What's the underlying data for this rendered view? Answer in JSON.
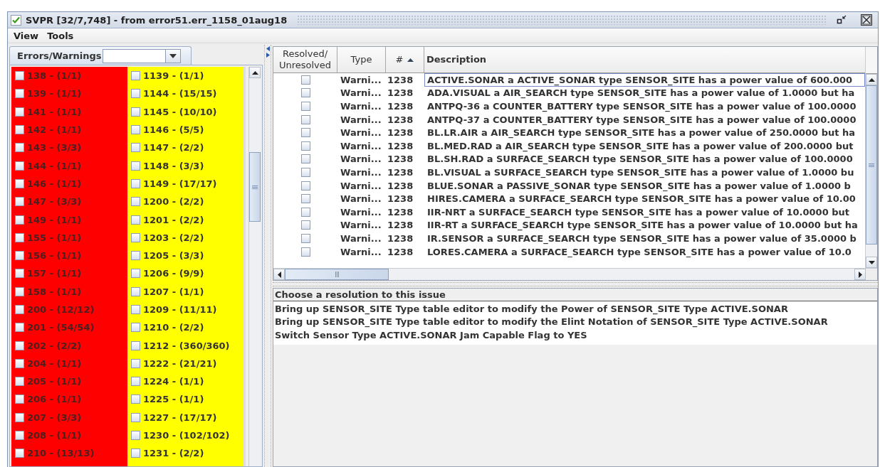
{
  "window": {
    "title": "SVPR [32/7,748] - from error51.err_1158_01aug18"
  },
  "menu": [
    "View",
    "Tools"
  ],
  "errors_panel": {
    "tab": "Errors/Warnings",
    "columns": [
      {
        "color": "#ff0000",
        "items": [
          {
            "label": "138 - (1/1)",
            "checked": false
          },
          {
            "label": "139 - (1/1)",
            "checked": false
          },
          {
            "label": "141 - (1/1)",
            "checked": false
          },
          {
            "label": "142 - (1/1)",
            "checked": false
          },
          {
            "label": "143 - (3/3)",
            "checked": false
          },
          {
            "label": "144 - (1/1)",
            "checked": false
          },
          {
            "label": "146 - (1/1)",
            "checked": false
          },
          {
            "label": "147 - (3/3)",
            "checked": false
          },
          {
            "label": "149 - (1/1)",
            "checked": false
          },
          {
            "label": "155 - (1/1)",
            "checked": false
          },
          {
            "label": "156 - (1/1)",
            "checked": false
          },
          {
            "label": "157 - (1/1)",
            "checked": false
          },
          {
            "label": "158 - (1/1)",
            "checked": false
          },
          {
            "label": "200 - (12/12)",
            "checked": false
          },
          {
            "label": "201 - (54/54)",
            "checked": false
          },
          {
            "label": "202 - (2/2)",
            "checked": false
          },
          {
            "label": "204 - (1/1)",
            "checked": false
          },
          {
            "label": "205 - (1/1)",
            "checked": false
          },
          {
            "label": "206 - (1/1)",
            "checked": false
          },
          {
            "label": "207 - (3/3)",
            "checked": false
          },
          {
            "label": "208 - (1/1)",
            "checked": false
          },
          {
            "label": "210 - (13/13)",
            "checked": false
          }
        ]
      },
      {
        "color": "#ffff00",
        "items": [
          {
            "label": "1139 - (1/1)",
            "checked": false
          },
          {
            "label": "1144 - (15/15)",
            "checked": false
          },
          {
            "label": "1145 - (10/10)",
            "checked": false
          },
          {
            "label": "1146 - (5/5)",
            "checked": false
          },
          {
            "label": "1147 - (2/2)",
            "checked": false
          },
          {
            "label": "1148 - (3/3)",
            "checked": false
          },
          {
            "label": "1149 - (17/17)",
            "checked": false
          },
          {
            "label": "1200 - (2/2)",
            "checked": false
          },
          {
            "label": "1201 - (2/2)",
            "checked": false
          },
          {
            "label": "1203 - (2/2)",
            "checked": false
          },
          {
            "label": "1205 - (3/3)",
            "checked": false
          },
          {
            "label": "1206 - (9/9)",
            "checked": false
          },
          {
            "label": "1207 - (1/1)",
            "checked": false
          },
          {
            "label": "1209 - (11/11)",
            "checked": false
          },
          {
            "label": "1210 - (2/2)",
            "checked": false
          },
          {
            "label": "1212 - (360/360)",
            "checked": false
          },
          {
            "label": "1222 - (21/21)",
            "checked": false
          },
          {
            "label": "1224 - (1/1)",
            "checked": false
          },
          {
            "label": "1225 - (1/1)",
            "checked": false
          },
          {
            "label": "1227 - (17/17)",
            "checked": false
          },
          {
            "label": "1230 - (102/102)",
            "checked": false
          },
          {
            "label": "1231 - (2/2)",
            "checked": false
          }
        ]
      }
    ]
  },
  "table": {
    "columns": [
      {
        "label": "Resolved/\nUnresolved",
        "sorted": false
      },
      {
        "label": "Type",
        "sorted": false
      },
      {
        "label": "#",
        "sorted": true
      },
      {
        "label": "Description",
        "sorted": false
      }
    ],
    "rows": [
      {
        "resolved": false,
        "selected": true,
        "type": "Warni...",
        "number": "1238",
        "description": "ACTIVE.SONAR a ACTIVE_SONAR type SENSOR_SITE has a power value of 600.000"
      },
      {
        "resolved": false,
        "selected": false,
        "type": "Warni...",
        "number": "1238",
        "description": "ADA.VISUAL a AIR_SEARCH type SENSOR_SITE has a power value of 1.0000 but ha"
      },
      {
        "resolved": false,
        "selected": false,
        "type": "Warni...",
        "number": "1238",
        "description": "ANTPQ-36 a COUNTER_BATTERY type SENSOR_SITE has a power value of 100.0000"
      },
      {
        "resolved": false,
        "selected": false,
        "type": "Warni...",
        "number": "1238",
        "description": "ANTPQ-37 a COUNTER_BATTERY type SENSOR_SITE has a power value of 100.0000"
      },
      {
        "resolved": false,
        "selected": false,
        "type": "Warni...",
        "number": "1238",
        "description": "BL.LR.AIR a AIR_SEARCH type SENSOR_SITE has a power value of 250.0000 but ha"
      },
      {
        "resolved": false,
        "selected": false,
        "type": "Warni...",
        "number": "1238",
        "description": "BL.MED.RAD a AIR_SEARCH type SENSOR_SITE has a power value of 200.0000 but"
      },
      {
        "resolved": false,
        "selected": false,
        "type": "Warni...",
        "number": "1238",
        "description": "BL.SH.RAD a SURFACE_SEARCH type SENSOR_SITE has a power value of 100.0000"
      },
      {
        "resolved": false,
        "selected": false,
        "type": "Warni...",
        "number": "1238",
        "description": "BL.VISUAL a SURFACE_SEARCH type SENSOR_SITE has a power value of 1.0000 bu"
      },
      {
        "resolved": false,
        "selected": false,
        "type": "Warni...",
        "number": "1238",
        "description": "BLUE.SONAR a PASSIVE_SONAR type SENSOR_SITE has a power value of 1.0000 b"
      },
      {
        "resolved": false,
        "selected": false,
        "type": "Warni...",
        "number": "1238",
        "description": "HIRES.CAMERA a SURFACE_SEARCH type SENSOR_SITE has a power value of 10.00"
      },
      {
        "resolved": false,
        "selected": false,
        "type": "Warni...",
        "number": "1238",
        "description": "IIR-NRT a SURFACE_SEARCH type SENSOR_SITE has a power value of 10.0000 but"
      },
      {
        "resolved": false,
        "selected": false,
        "type": "Warni...",
        "number": "1238",
        "description": "IIR-RT a SURFACE_SEARCH type SENSOR_SITE has a power value of 10.0000 but ha"
      },
      {
        "resolved": false,
        "selected": false,
        "type": "Warni...",
        "number": "1238",
        "description": "IR.SENSOR a SURFACE_SEARCH type SENSOR_SITE has a power value of 35.0000 b"
      },
      {
        "resolved": false,
        "selected": false,
        "type": "Warni...",
        "number": "1238",
        "description": "LORES.CAMERA a SURFACE_SEARCH type SENSOR_SITE has a power value of 10.0"
      }
    ]
  },
  "resolutions": {
    "header": "Choose a resolution to this issue",
    "options": [
      "Bring up SENSOR_SITE Type table editor to modify the Power of SENSOR_SITE Type ACTIVE.SONAR",
      "Bring up SENSOR_SITE Type table editor to modify the Elint Notation of SENSOR_SITE Type ACTIVE.SONAR",
      "Switch Sensor Type ACTIVE.SONAR Jam Capable Flag to YES"
    ]
  }
}
